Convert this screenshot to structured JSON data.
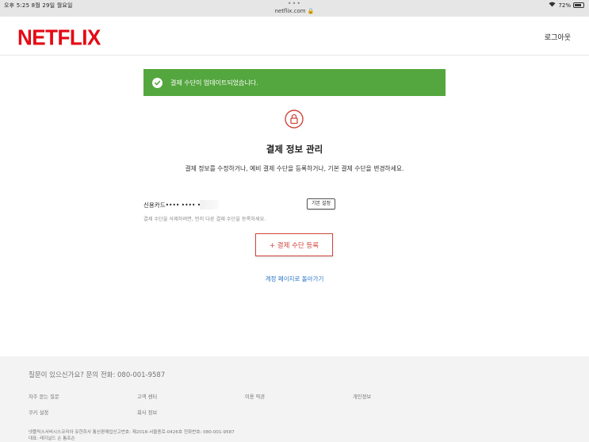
{
  "status_bar": {
    "time": "오후 5:25   8월 29일 월요일",
    "dots": "•••",
    "url": "netflix.com 🔒",
    "battery_text": "72%",
    "wifi_icon": "wifi-icon"
  },
  "header": {
    "logo": "NETFLIX",
    "logout_label": "로그아웃"
  },
  "banner": {
    "message": "결제 수단이 업데이트되었습니다.",
    "color": "#54a63f"
  },
  "main": {
    "title": "결제 정보 관리",
    "subtitle": "결제 정보를 수정하거나, 예비 결제 수단을 등록하거나, 기본 결제 수단을 변경하세요.",
    "card_label": "신용카드•••• •••• ••••",
    "default_badge": "기본 설정",
    "note": "결제 수단을 삭제하려면, 먼저 다른 결제 수단을 등록하세요.",
    "add_button": "+ 결제 수단 등록",
    "back_link": "계정 페이지로 돌아가기",
    "accent_color": "#d0463f"
  },
  "footer": {
    "question": "질문이 있으신가요? 문의 전화:  080-001-9587",
    "links": [
      "자주 묻는 질문",
      "고객 센터",
      "이용 약관",
      "개인정보",
      "쿠키 설정",
      "회사 정보"
    ],
    "legal_line1": "넷플릭스서비시스코리아 유한회사 통신판매업신고번호: 제2018-서울종로-0426호 전화번호: 080-001-9587",
    "legal_line2": "대표: 레지널드 숀 톰프슨"
  }
}
